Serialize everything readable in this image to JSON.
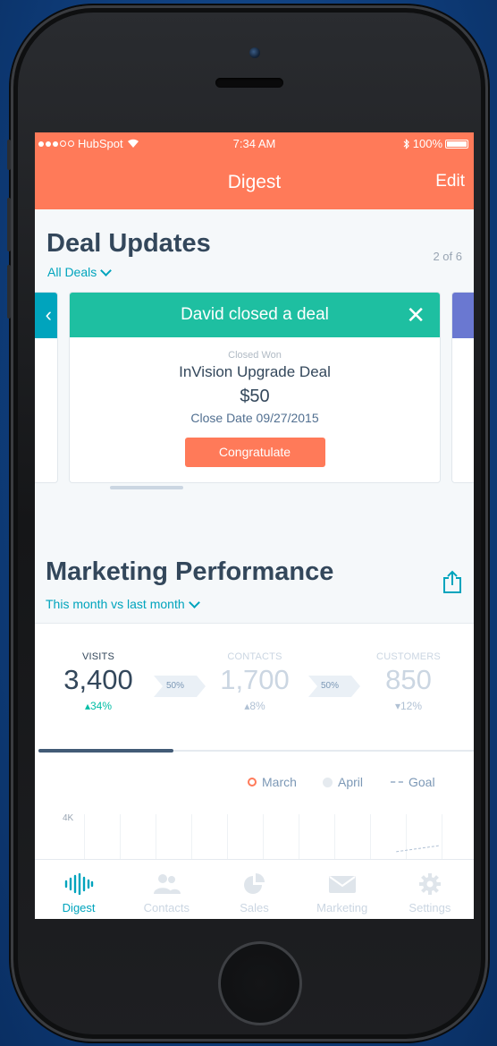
{
  "status_bar": {
    "carrier": "HubSpot",
    "time": "7:34 AM",
    "battery": "100%"
  },
  "header": {
    "title": "Digest",
    "edit_label": "Edit"
  },
  "deal_updates": {
    "title": "Deal Updates",
    "filter": "All Deals",
    "pager": "2 of 6",
    "card": {
      "headline": "David closed a deal",
      "close_symbol": "✕",
      "stage": "Closed Won",
      "deal_name": "InVision Upgrade Deal",
      "amount": "$50",
      "close_date": "Close Date 09/27/2015",
      "action_label": "Congratulate"
    },
    "prev_symbol": "‹"
  },
  "marketing": {
    "title": "Marketing Performance",
    "filter": "This month vs last month",
    "metrics": [
      {
        "label": "VISITS",
        "value": "3,400",
        "change": "▴34%"
      },
      {
        "label": "CONTACTS",
        "value": "1,700",
        "change": "▴8%"
      },
      {
        "label": "CUSTOMERS",
        "value": "850",
        "change": "▾12%"
      }
    ],
    "conversions": [
      "50%",
      "50%"
    ],
    "progress": 0.31,
    "legend": {
      "march": "March",
      "april": "April",
      "goal": "Goal"
    },
    "y_top_label": "4K"
  },
  "tabs": [
    {
      "label": "Digest",
      "icon": "digest-icon",
      "active": true
    },
    {
      "label": "Contacts",
      "icon": "contacts-icon",
      "active": false
    },
    {
      "label": "Sales",
      "icon": "sales-icon",
      "active": false
    },
    {
      "label": "Marketing",
      "icon": "marketing-icon",
      "active": false
    },
    {
      "label": "Settings",
      "icon": "settings-icon",
      "active": false
    }
  ],
  "colors": {
    "brand_orange": "#ff7a59",
    "teal": "#00a4bd",
    "deal_green": "#1ebfa1",
    "text_dark": "#33475b"
  }
}
